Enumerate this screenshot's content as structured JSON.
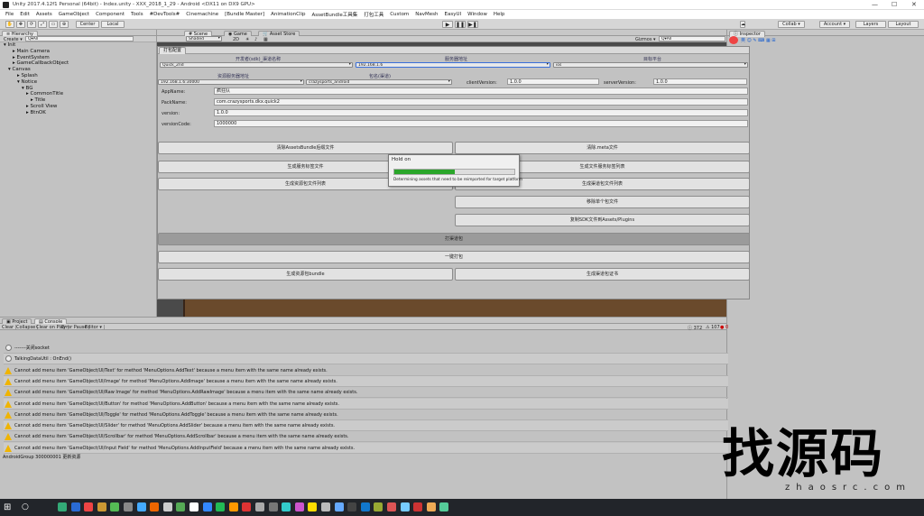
{
  "window": {
    "title": "Unity 2017.4.12f1 Personal (64bit) - Index.unity - XXX_2018_1_29 - Android <DX11 on DX9 GPU>",
    "minimize": "—",
    "maximize": "☐",
    "close": "✕"
  },
  "menubar": [
    "File",
    "Edit",
    "Assets",
    "GameObject",
    "Component",
    "Tools",
    "#DevTools#",
    "Cinemachine",
    "[Bundle Master]",
    "AnimationClip",
    "AssetBundle工具集",
    "打包工具",
    "Custom",
    "NavMesh",
    "EasyUI",
    "Window",
    "Help"
  ],
  "toolbar": {
    "center_label": "Center",
    "local_label": "Local",
    "collab_label": "Collab ▾",
    "account_label": "Account ▾",
    "layers_label": "Layers",
    "layout_label": "Layout"
  },
  "hierarchy": {
    "tab": "Hierarchy",
    "create": "Create ▾",
    "search": "Q▾All",
    "items": [
      {
        "label": "Init",
        "indent": 0
      },
      {
        "label": "Main Camera",
        "indent": 2
      },
      {
        "label": "EventSystem",
        "indent": 2
      },
      {
        "label": "GameCallbackObject",
        "indent": 2
      },
      {
        "label": "Canvas",
        "indent": 1
      },
      {
        "label": "Splash",
        "indent": 3
      },
      {
        "label": "Notice",
        "indent": 3
      },
      {
        "label": "BG",
        "indent": 4
      },
      {
        "label": "CommonTitle",
        "indent": 5
      },
      {
        "label": "Title",
        "indent": 6
      },
      {
        "label": "Scroll View",
        "indent": 5
      },
      {
        "label": "BtnOK",
        "indent": 5
      }
    ]
  },
  "scene_tabs": {
    "scene": "Scene",
    "game": "Game",
    "asset_store": "Asset Store",
    "shaded": "Shaded",
    "mode_2d": "2D",
    "gizmos": "Gizmos ▾",
    "search": "Q▾All"
  },
  "build_window": {
    "tab": "打包配置",
    "header_labels": [
      "开发者(sdk)_渠道名称",
      "服务器地址",
      "目标平台"
    ],
    "channel": "Quick_2nd",
    "server_addr": "192.168.1.6",
    "platform": "ios",
    "sublabel": "资源服务器地址",
    "sublabel2": "包名(渠道)",
    "res_server": "192.168.1.6:30000",
    "package_channel": "crazysports_android",
    "client_version_label": "clientVersion:",
    "client_version": "1.0.0",
    "server_version_label": "serverVersion:",
    "server_version": "1.0.0",
    "fields": [
      {
        "label": "AppName:",
        "value": "疯狂队"
      },
      {
        "label": "PackName:",
        "value": "com.crazysports.dkx.quick2"
      },
      {
        "label": "version:",
        "value": "1.0.0"
      },
      {
        "label": "versionCode:",
        "value": "1000000"
      }
    ],
    "buttons": {
      "clear_ab": "清除AssetsBundle后缀文件",
      "clear_meta": "清除.meta文件",
      "gen_flags": "生成服务标签文件",
      "gen_files_list": "生成文件服务标签列表",
      "gen_res_list": "生成资源包文件列表",
      "gen_update_list": "生成渠道包文件列表",
      "move_single": "移除单个包文件",
      "copy_sdk": "复制SDK文件到Assets/Plugins",
      "build_pkg": "打渠道包",
      "build": "一键打包",
      "gen_resbundle": "生成资源包bundle",
      "gen_apk": "生成渠道包证书"
    }
  },
  "progress_dialog": {
    "title": "Hold on",
    "message": "Determining assets that need to be reimported for target platform",
    "progress": 0.5
  },
  "inspector": {
    "tab": "Inspector"
  },
  "console": {
    "tabs": [
      "Project",
      "Console"
    ],
    "buttons": [
      "Clear",
      "Collapse",
      "Clear on Play",
      "Error Pause",
      "Editor ▾"
    ],
    "count_info": "372",
    "count_warn": "107",
    "count_err": "0",
    "rows": [
      {
        "type": "info",
        "text": "-------关闭socket"
      },
      {
        "type": "info",
        "text": "TalkingDataUtil : OnEnd()"
      },
      {
        "type": "warn",
        "text": "Cannot add menu item 'GameObject/UI/Text' for method 'MenuOptions.AddText' because a menu item with the same name already exists."
      },
      {
        "type": "warn",
        "text": "Cannot add menu item 'GameObject/UI/Image' for method 'MenuOptions.AddImage' because a menu item with the same name already exists."
      },
      {
        "type": "warn",
        "text": "Cannot add menu item 'GameObject/UI/Raw Image' for method 'MenuOptions.AddRawImage' because a menu item with the same name already exists."
      },
      {
        "type": "warn",
        "text": "Cannot add menu item 'GameObject/UI/Button' for method 'MenuOptions.AddButton' because a menu item with the same name already exists."
      },
      {
        "type": "warn",
        "text": "Cannot add menu item 'GameObject/UI/Toggle' for method 'MenuOptions.AddToggle' because a menu item with the same name already exists."
      },
      {
        "type": "warn",
        "text": "Cannot add menu item 'GameObject/UI/Slider' for method 'MenuOptions.AddSlider' because a menu item with the same name already exists."
      },
      {
        "type": "warn",
        "text": "Cannot add menu item 'GameObject/UI/Scrollbar' for method 'MenuOptions.AddScrollbar' because a menu item with the same name already exists."
      },
      {
        "type": "warn",
        "text": "Cannot add menu item 'GameObject/UI/Input Field' for method 'MenuOptions.AddInputField' because a menu item with the same name already exists."
      }
    ]
  },
  "status_bar": "AndroidGroup 300000001 更新资源",
  "watermark": {
    "main": "找源码",
    "sub": "zhaosrc.com"
  },
  "colors": {
    "progress": "#2aa62a",
    "warning": "#f0b400",
    "taskbar": "#22252a"
  }
}
